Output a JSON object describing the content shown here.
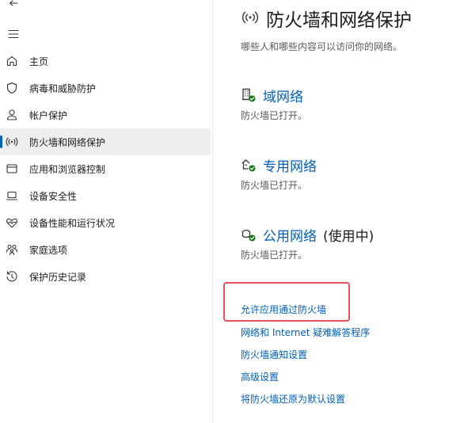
{
  "sidebar": {
    "items": [
      {
        "label": "主页",
        "icon": "home-icon"
      },
      {
        "label": "病毒和威胁防护",
        "icon": "shield-icon"
      },
      {
        "label": "帐户保护",
        "icon": "account-icon"
      },
      {
        "label": "防火墙和网络保护",
        "icon": "wifi-icon",
        "selected": true
      },
      {
        "label": "应用和浏览器控制",
        "icon": "app-window-icon"
      },
      {
        "label": "设备安全性",
        "icon": "laptop-icon"
      },
      {
        "label": "设备性能和运行状况",
        "icon": "heart-pulse-icon"
      },
      {
        "label": "家庭选项",
        "icon": "family-icon"
      },
      {
        "label": "保护历史记录",
        "icon": "history-icon"
      }
    ]
  },
  "main": {
    "title": "防火墙和网络保护",
    "subtitle": "哪些人和哪些内容可以访问你的网络。",
    "networks": [
      {
        "name": "域网络",
        "extra": "",
        "status": "防火墙已打开。",
        "icon": "domain-network-icon"
      },
      {
        "name": "专用网络",
        "extra": "",
        "status": "防火墙已打开。",
        "icon": "private-network-icon"
      },
      {
        "name": "公用网络",
        "extra": "(使用中)",
        "status": "防火墙已打开。",
        "icon": "public-network-icon"
      }
    ],
    "links": [
      "允许应用通过防火墙",
      "网络和 Internet 疑难解答程序",
      "防火墙通知设置",
      "高级设置",
      "将防火墙还原为默认设置"
    ]
  },
  "colors": {
    "accent": "#005fb8",
    "highlight": "#e8505b",
    "ok": "#107c10"
  }
}
